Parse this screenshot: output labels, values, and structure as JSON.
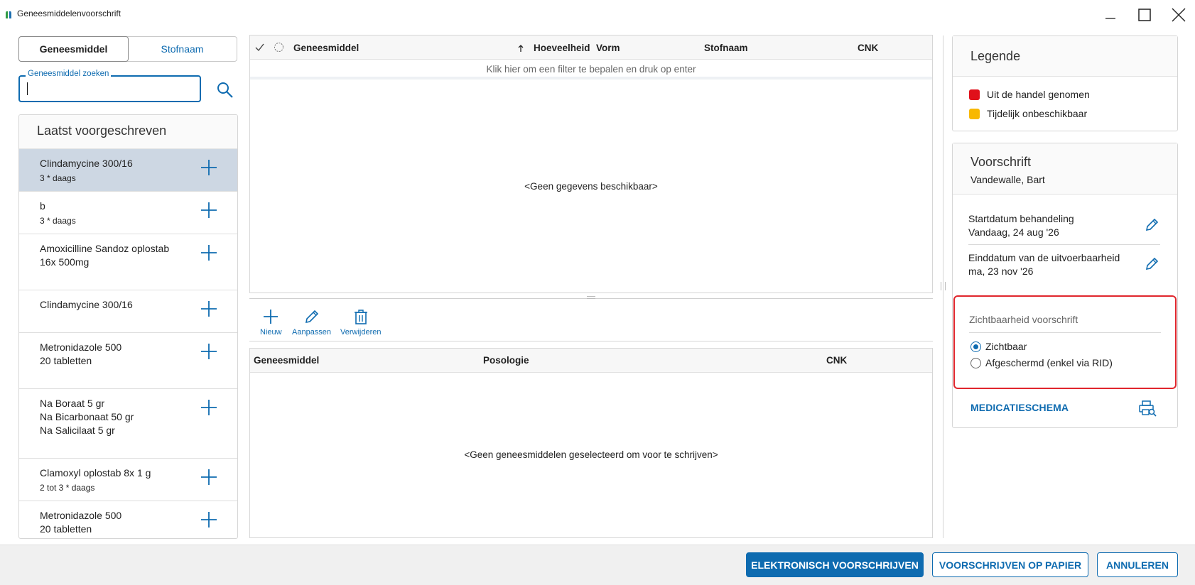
{
  "window": {
    "title": "Geneesmiddelenvoorschrift"
  },
  "search_mode": {
    "tabs": [
      {
        "label": "Geneesmiddel",
        "active": true
      },
      {
        "label": "Stofnaam",
        "active": false
      }
    ]
  },
  "search": {
    "label": "Geneesmiddel zoeken",
    "value": "",
    "placeholder": ""
  },
  "recent": {
    "title": "Laatst voorgeschreven",
    "items": [
      {
        "name": "Clindamycine  300/16",
        "sub": "3 * daags",
        "selected": true
      },
      {
        "name": "b",
        "sub": "3 * daags"
      },
      {
        "name": "Amoxicilline Sandoz oplostab 16x 500mg",
        "sub": ""
      },
      {
        "name": "Clindamycine  300/16",
        "sub": ""
      },
      {
        "name": "Metronidazole 500\n20 tabletten",
        "sub": ""
      },
      {
        "name": "Na Boraat 5 gr\nNa Bicarbonaat 50 gr\nNa Salicilaat 5 gr",
        "sub": ""
      },
      {
        "name": "Clamoxyl oplostab 8x 1 g",
        "sub": "2 tot 3 * daags"
      },
      {
        "name": "Metronidazole 500\n20 tabletten",
        "sub": ""
      }
    ]
  },
  "results_grid": {
    "columns": [
      "Geneesmiddel",
      "Hoeveelheid",
      "Vorm",
      "Stofnaam",
      "CNK"
    ],
    "filter_hint": "Klik hier om een filter te bepalen en druk op enter",
    "empty": "<Geen gegevens beschikbaar>"
  },
  "toolbar": {
    "new_label": "Nieuw",
    "edit_label": "Aanpassen",
    "delete_label": "Verwijderen"
  },
  "selected_grid": {
    "columns": [
      "Geneesmiddel",
      "Posologie",
      "CNK"
    ],
    "empty": "<Geen geneesmiddelen geselecteerd om voor te schrijven>"
  },
  "legend": {
    "title": "Legende",
    "items": [
      {
        "label": "Uit de handel genomen",
        "color": "#e0101a"
      },
      {
        "label": "Tijdelijk onbeschikbaar",
        "color": "#f8b800"
      }
    ]
  },
  "prescription": {
    "title": "Voorschrift",
    "patient": "Vandewalle, Bart",
    "start_label": "Startdatum behandeling",
    "start_value": "Vandaag, 24 aug '26",
    "end_label": "Einddatum van de uitvoerbaarheid",
    "end_value": "ma, 23 nov '26",
    "visibility_title": "Zichtbaarheid voorschrift",
    "visibility_options": [
      {
        "label": "Zichtbaar",
        "checked": true
      },
      {
        "label": "Afgeschermd (enkel via RID)",
        "checked": false
      }
    ],
    "schema_link": "MEDICATIESCHEMA"
  },
  "footer": {
    "electronic": "ELEKTRONISCH VOORSCHRIJVEN",
    "paper": "VOORSCHRIJVEN OP PAPIER",
    "cancel": "ANNULEREN"
  },
  "colors": {
    "accent": "#0e6bb0",
    "highlight_border": "#e0262d",
    "selected_row": "#cdd7e3"
  }
}
